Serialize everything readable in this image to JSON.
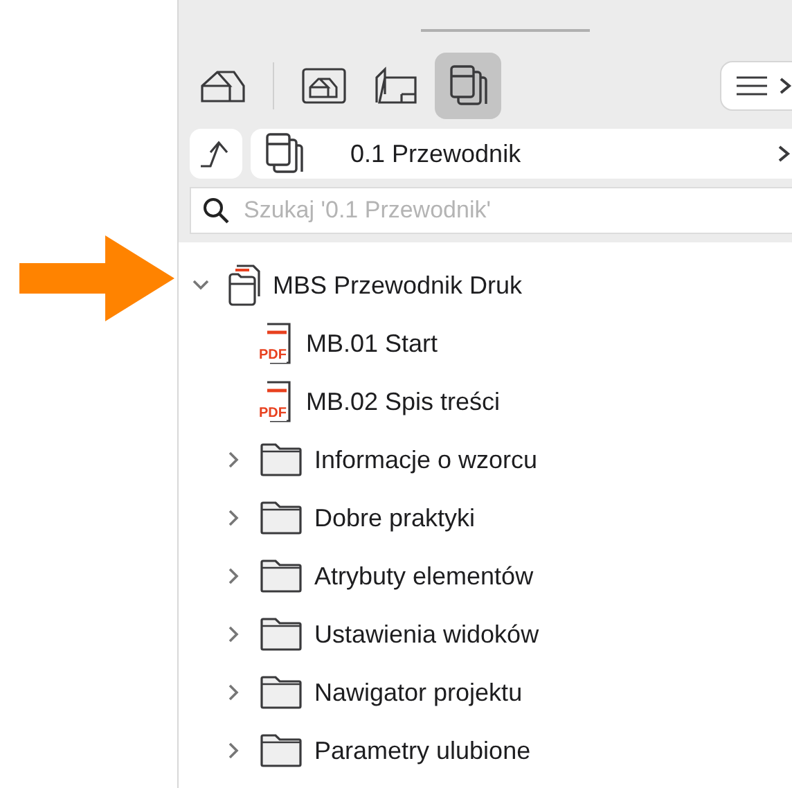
{
  "toolbar": {
    "buttons": [
      {
        "kind": "model",
        "selected": false
      },
      {
        "kind": "views",
        "selected": false
      },
      {
        "kind": "layouts",
        "selected": false
      },
      {
        "kind": "publisher",
        "selected": true
      }
    ]
  },
  "path": {
    "label": "0.1 Przewodnik"
  },
  "search": {
    "placeholder": "Szukaj '0.1 Przewodnik'"
  },
  "tree": [
    {
      "kind": "set",
      "label": "MBS Przewodnik Druk",
      "expanded": true,
      "children": [
        {
          "kind": "pdf",
          "label": "MB.01 Start",
          "icon_text": "PDF"
        },
        {
          "kind": "pdf",
          "label": "MB.02 Spis treści",
          "icon_text": "PDF"
        },
        {
          "kind": "folder",
          "label": "Informacje o wzorcu",
          "expanded": false
        },
        {
          "kind": "folder",
          "label": "Dobre praktyki",
          "expanded": false
        },
        {
          "kind": "folder",
          "label": "Atrybuty elementów",
          "expanded": false
        },
        {
          "kind": "folder",
          "label": "Ustawienia widoków",
          "expanded": false
        },
        {
          "kind": "folder",
          "label": "Nawigator projektu",
          "expanded": false
        },
        {
          "kind": "folder",
          "label": "Parametry ulubione",
          "expanded": false
        }
      ]
    }
  ]
}
